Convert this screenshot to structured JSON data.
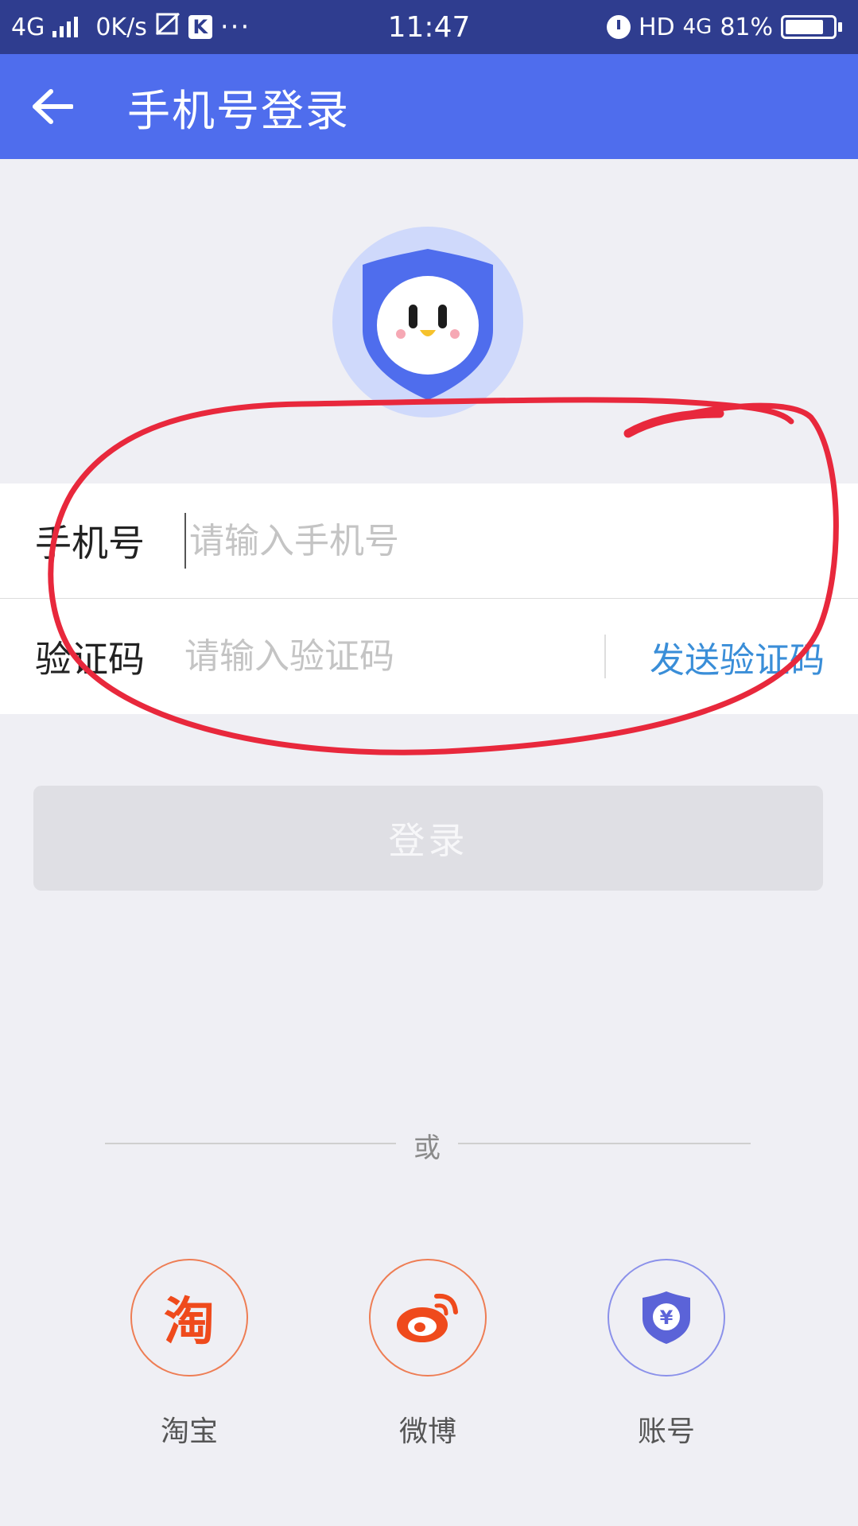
{
  "status_bar": {
    "network": "4G",
    "speed": "0K/s",
    "k_badge": "K",
    "dots": "···",
    "time": "11:47",
    "hd": "HD",
    "net_right": "4G",
    "battery": "81%",
    "battery_level": 0.81
  },
  "app_bar": {
    "title": "手机号登录"
  },
  "form": {
    "phone_label": "手机号",
    "phone_placeholder": "请输入手机号",
    "code_label": "验证码",
    "code_placeholder": "请输入验证码",
    "send_code": "发送验证码"
  },
  "login_button": "登录",
  "or_text": "或",
  "social": {
    "taobao_label": "淘宝",
    "taobao_glyph": "淘",
    "weibo_label": "微博",
    "account_label": "账号",
    "account_glyph": "¥"
  },
  "colors": {
    "status_bar": "#2f3d8f",
    "app_bar": "#4f6ded",
    "link": "#3a8ed8",
    "annotation": "#e8283c",
    "taobao": "#ef4a1c",
    "weibo": "#ef4a1c",
    "account": "#5b63d8"
  },
  "icons": [
    "back-arrow-icon",
    "mascot-logo-icon",
    "taobao-icon",
    "weibo-icon",
    "account-shield-icon",
    "alarm-icon",
    "battery-icon",
    "signal-icon"
  ]
}
